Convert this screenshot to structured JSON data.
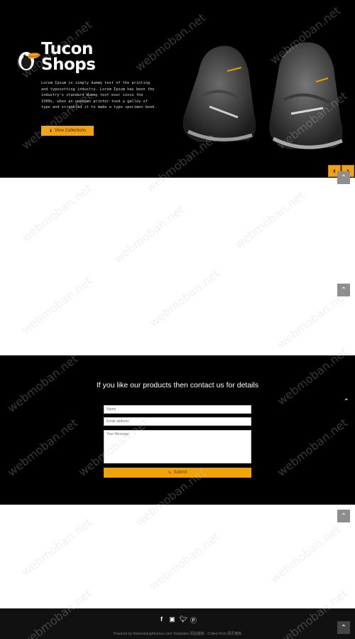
{
  "hero": {
    "brand_line1": "Tucon",
    "brand_line2": "Shops",
    "description": "Lorem Ipsum is simply dummy text of the printing and typesetting industry. Lorem Ipsum has been the industry's standard dummy text ever since the 1500s, when an unknown printer took a galley of type and scrambled it to make a type specimen book.",
    "download_label": "View Collections",
    "prev_icon": "chevron-left-icon",
    "next_icon": "chevron-right-icon"
  },
  "contact": {
    "title": "If you like our products then contact us for details",
    "name_placeholder": "Name",
    "email_placeholder": "Email address",
    "message_placeholder": "Your Message",
    "submit_label": "Submit"
  },
  "footer": {
    "social": [
      "facebook-icon",
      "instagram-icon",
      "twitter-icon",
      "pinterest-icon"
    ],
    "copyright": "Powered by thebootstrapthemes.com Templates 网站模板 - Collect from 网页模板"
  },
  "watermark": "webmoban.net",
  "colors": {
    "accent": "#f0a20f",
    "hero_bg": "#000000",
    "footer_bg": "#111111"
  }
}
